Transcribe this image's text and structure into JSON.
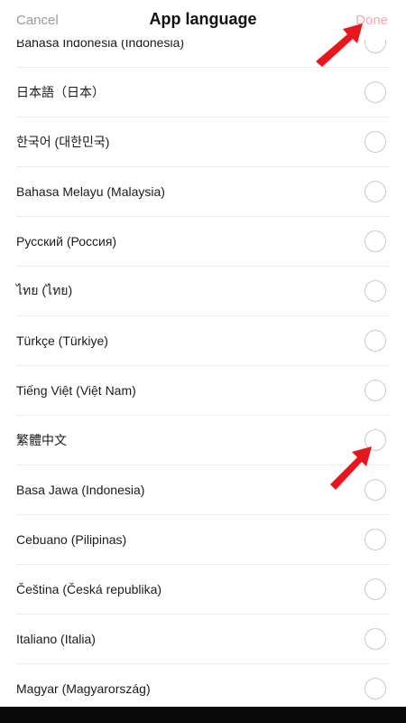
{
  "header": {
    "cancel_label": "Cancel",
    "title": "App language",
    "done_label": "Done"
  },
  "languages": [
    "Bahasa Indonesia (Indonesia)",
    "日本語（日本）",
    "한국어 (대한민국)",
    "Bahasa Melayu (Malaysia)",
    "Русский (Россия)",
    "ไทย (ไทย)",
    "Türkçe (Türkiye)",
    "Tiếng Việt (Việt Nam)",
    "繁體中文",
    "Basa Jawa (Indonesia)",
    "Cebuano (Pilipinas)",
    "Čeština (Česká republika)",
    "Italiano (Italia)",
    "Magyar (Magyarország)"
  ],
  "colors": {
    "arrow": "#e8161d",
    "done_disabled": "#f6a8ae",
    "cancel": "#9a9a9a",
    "radio_border": "#c9c9c9"
  },
  "icons": {
    "radio": "radio-unselected-icon",
    "annotation": "red-arrow-icon"
  }
}
